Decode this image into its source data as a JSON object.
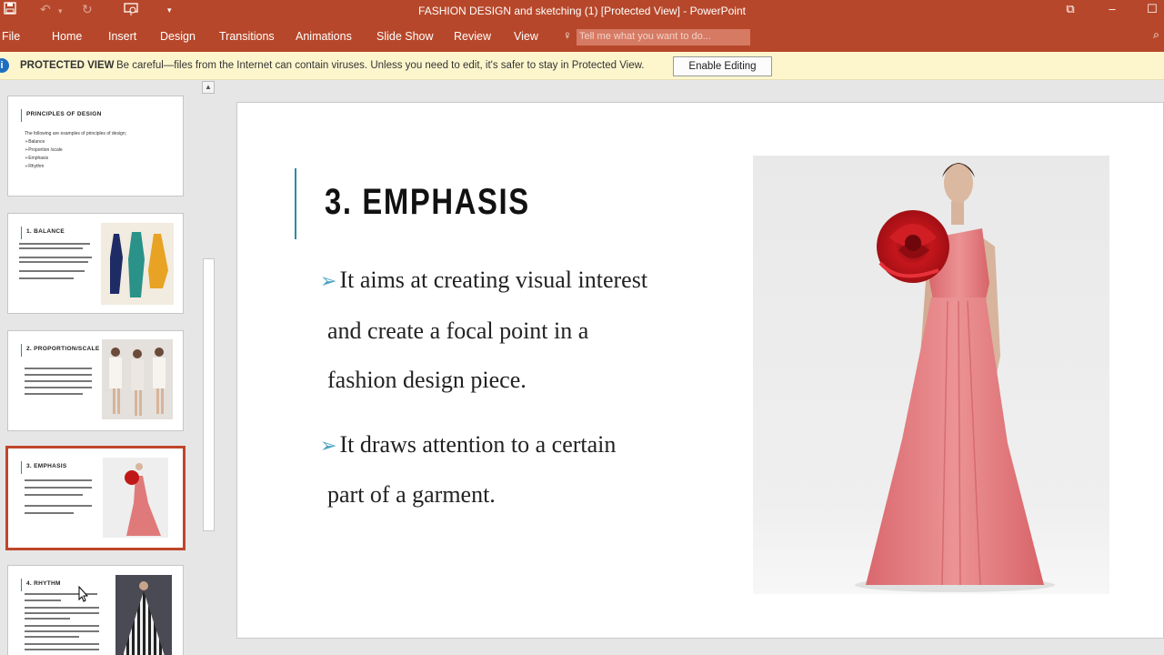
{
  "titlebar": {
    "title": "FASHION DESIGN and sketching (1) [Protected View] - PowerPoint",
    "save_icon": "save-icon",
    "undo_icon": "undo-icon",
    "redo_icon": "redo-icon",
    "present_icon": "present-from-start-icon",
    "customize_icon": "customize-quick-access-icon"
  },
  "ribbon": {
    "tabs": [
      "File",
      "Home",
      "Insert",
      "Design",
      "Transitions",
      "Animations",
      "Slide Show",
      "Review",
      "View"
    ],
    "tell_me_placeholder": "Tell me what you want to do..."
  },
  "protected_view": {
    "label": "PROTECTED VIEW",
    "message": "Be careful—files from the Internet can contain viruses. Unless you need to edit, it's safer to stay in Protected View.",
    "button": "Enable Editing"
  },
  "thumbnails": [
    {
      "title": "PRINCIPLES OF DESIGN",
      "lines": [
        "The following are examples of principles of design;",
        "➢Balance",
        "➢Proportion /scale",
        "➢Emphasis",
        "➢Rhythm"
      ]
    },
    {
      "title": "1. BALANCE"
    },
    {
      "title": "2. PROPORTION/SCALE"
    },
    {
      "title": "3. EMPHASIS"
    },
    {
      "title": "4. RHYTHM"
    }
  ],
  "slide": {
    "title": "3. EMPHASIS",
    "bullet1_line1": "It aims at creating visual interest",
    "bullet1_line2": "and create a focal point in a",
    "bullet1_line3": "fashion design piece.",
    "bullet2_line1": "It draws attention to a certain",
    "bullet2_line2": "part of  a garment."
  },
  "colors": {
    "accent": "#b7472a",
    "protected_bar": "#fdf6cd",
    "title_accent": "#2a8ba0",
    "bullet_arrow": "#4aa3c4"
  }
}
